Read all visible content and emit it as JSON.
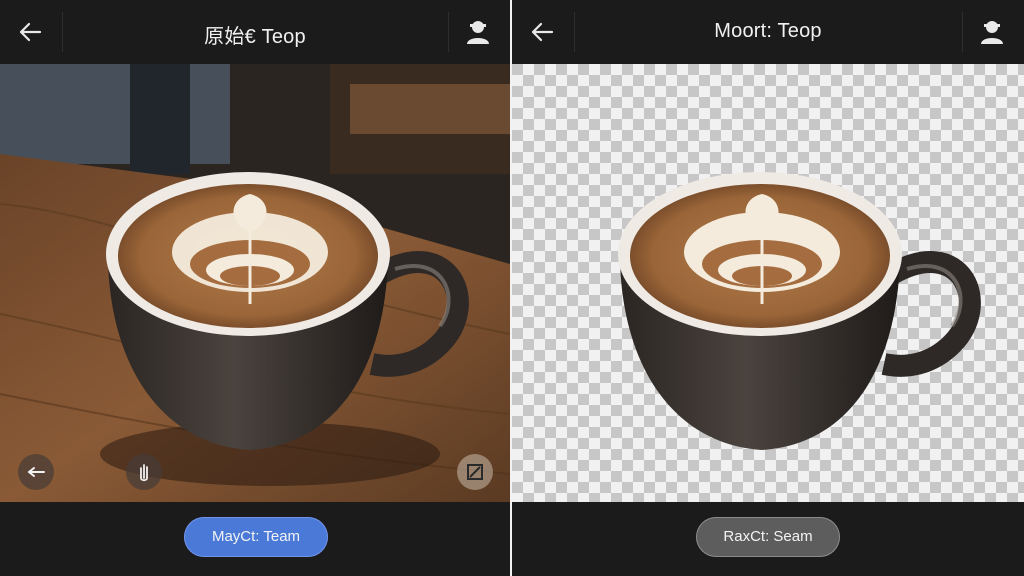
{
  "left_panel": {
    "title": "原始€ Teop",
    "button_label": "MayCt: Team"
  },
  "right_panel": {
    "title": "Moort: Teop",
    "button_label": "RaxCt: Seam"
  },
  "icons": {
    "back": "arrow-left-icon",
    "profile": "user-avatar-icon",
    "rotate_left": "rotate-left-icon",
    "pan": "hand-icon",
    "crop": "crop-icon"
  },
  "colors": {
    "topbar": "#1b1b1b",
    "primary_button": "#4a79d8",
    "secondary_button": "#5d5d5d",
    "checker_light": "#f1f1f1",
    "checker_dark": "#c7c7c7"
  }
}
